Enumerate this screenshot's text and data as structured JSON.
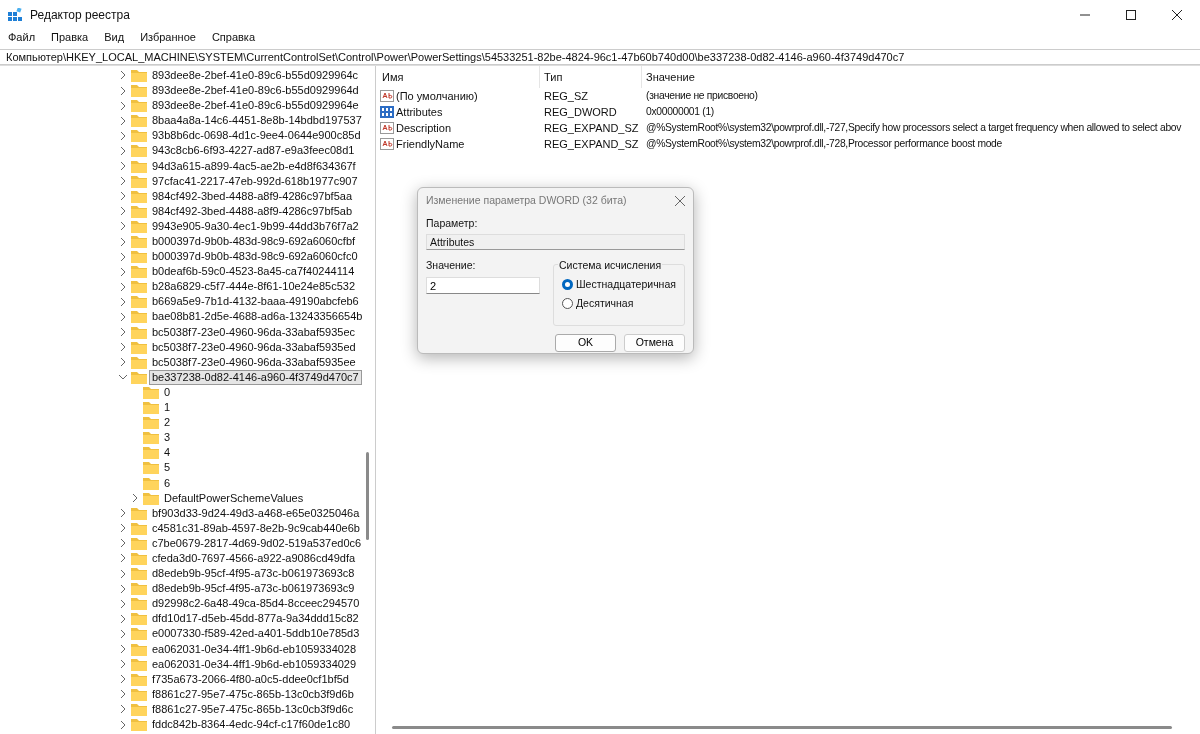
{
  "window": {
    "title": "Редактор реестра"
  },
  "menu": [
    "Файл",
    "Правка",
    "Вид",
    "Избранное",
    "Справка"
  ],
  "address": "Компьютер\\HKEY_LOCAL_MACHINE\\SYSTEM\\CurrentControlSet\\Control\\Power\\PowerSettings\\54533251-82be-4824-96c1-47b60b740d00\\be337238-0d82-4146-a960-4f3749d470c7",
  "tree": {
    "items": [
      {
        "label": "893dee8e-2bef-41e0-89c6-b55d0929964c",
        "expandable": true,
        "expanded": false,
        "selected": false
      },
      {
        "label": "893dee8e-2bef-41e0-89c6-b55d0929964d",
        "expandable": true,
        "expanded": false,
        "selected": false
      },
      {
        "label": "893dee8e-2bef-41e0-89c6-b55d0929964e",
        "expandable": true,
        "expanded": false,
        "selected": false
      },
      {
        "label": "8baa4a8a-14c6-4451-8e8b-14bdbd197537",
        "expandable": true,
        "expanded": false,
        "selected": false
      },
      {
        "label": "93b8b6dc-0698-4d1c-9ee4-0644e900c85d",
        "expandable": true,
        "expanded": false,
        "selected": false
      },
      {
        "label": "943c8cb6-6f93-4227-ad87-e9a3feec08d1",
        "expandable": true,
        "expanded": false,
        "selected": false
      },
      {
        "label": "94d3a615-a899-4ac5-ae2b-e4d8f634367f",
        "expandable": true,
        "expanded": false,
        "selected": false
      },
      {
        "label": "97cfac41-2217-47eb-992d-618b1977c907",
        "expandable": true,
        "expanded": false,
        "selected": false
      },
      {
        "label": "984cf492-3bed-4488-a8f9-4286c97bf5aa",
        "expandable": true,
        "expanded": false,
        "selected": false
      },
      {
        "label": "984cf492-3bed-4488-a8f9-4286c97bf5ab",
        "expandable": true,
        "expanded": false,
        "selected": false
      },
      {
        "label": "9943e905-9a30-4ec1-9b99-44dd3b76f7a2",
        "expandable": true,
        "expanded": false,
        "selected": false
      },
      {
        "label": "b000397d-9b0b-483d-98c9-692a6060cfbf",
        "expandable": true,
        "expanded": false,
        "selected": false
      },
      {
        "label": "b000397d-9b0b-483d-98c9-692a6060cfc0",
        "expandable": true,
        "expanded": false,
        "selected": false
      },
      {
        "label": "b0deaf6b-59c0-4523-8a45-ca7f40244114",
        "expandable": true,
        "expanded": false,
        "selected": false
      },
      {
        "label": "b28a6829-c5f7-444e-8f61-10e24e85c532",
        "expandable": true,
        "expanded": false,
        "selected": false
      },
      {
        "label": "b669a5e9-7b1d-4132-baaa-49190abcfeb6",
        "expandable": true,
        "expanded": false,
        "selected": false
      },
      {
        "label": "bae08b81-2d5e-4688-ad6a-13243356654b",
        "expandable": true,
        "expanded": false,
        "selected": false
      },
      {
        "label": "bc5038f7-23e0-4960-96da-33abaf5935ec",
        "expandable": true,
        "expanded": false,
        "selected": false
      },
      {
        "label": "bc5038f7-23e0-4960-96da-33abaf5935ed",
        "expandable": true,
        "expanded": false,
        "selected": false
      },
      {
        "label": "bc5038f7-23e0-4960-96da-33abaf5935ee",
        "expandable": true,
        "expanded": false,
        "selected": false
      },
      {
        "label": "be337238-0d82-4146-a960-4f3749d470c7",
        "expandable": true,
        "expanded": true,
        "selected": true,
        "children": [
          {
            "label": "0",
            "expandable": false,
            "selected": false
          },
          {
            "label": "1",
            "expandable": false,
            "selected": false
          },
          {
            "label": "2",
            "expandable": false,
            "selected": false
          },
          {
            "label": "3",
            "expandable": false,
            "selected": false
          },
          {
            "label": "4",
            "expandable": false,
            "selected": false
          },
          {
            "label": "5",
            "expandable": false,
            "selected": false
          },
          {
            "label": "6",
            "expandable": false,
            "selected": false
          },
          {
            "label": "DefaultPowerSchemeValues",
            "expandable": true,
            "expanded": false,
            "selected": false
          }
        ]
      },
      {
        "label": "bf903d33-9d24-49d3-a468-e65e0325046a",
        "expandable": true,
        "expanded": false,
        "selected": false
      },
      {
        "label": "c4581c31-89ab-4597-8e2b-9c9cab440e6b",
        "expandable": true,
        "expanded": false,
        "selected": false
      },
      {
        "label": "c7be0679-2817-4d69-9d02-519a537ed0c6",
        "expandable": true,
        "expanded": false,
        "selected": false
      },
      {
        "label": "cfeda3d0-7697-4566-a922-a9086cd49dfa",
        "expandable": true,
        "expanded": false,
        "selected": false
      },
      {
        "label": "d8edeb9b-95cf-4f95-a73c-b061973693c8",
        "expandable": true,
        "expanded": false,
        "selected": false
      },
      {
        "label": "d8edeb9b-95cf-4f95-a73c-b061973693c9",
        "expandable": true,
        "expanded": false,
        "selected": false
      },
      {
        "label": "d92998c2-6a48-49ca-85d4-8cceec294570",
        "expandable": true,
        "expanded": false,
        "selected": false
      },
      {
        "label": "dfd10d17-d5eb-45dd-877a-9a34ddd15c82",
        "expandable": true,
        "expanded": false,
        "selected": false
      },
      {
        "label": "e0007330-f589-42ed-a401-5ddb10e785d3",
        "expandable": true,
        "expanded": false,
        "selected": false
      },
      {
        "label": "ea062031-0e34-4ff1-9b6d-eb1059334028",
        "expandable": true,
        "expanded": false,
        "selected": false
      },
      {
        "label": "ea062031-0e34-4ff1-9b6d-eb1059334029",
        "expandable": true,
        "expanded": false,
        "selected": false
      },
      {
        "label": "f735a673-2066-4f80-a0c5-ddee0cf1bf5d",
        "expandable": true,
        "expanded": false,
        "selected": false
      },
      {
        "label": "f8861c27-95e7-475c-865b-13c0cb3f9d6b",
        "expandable": true,
        "expanded": false,
        "selected": false
      },
      {
        "label": "f8861c27-95e7-475c-865b-13c0cb3f9d6c",
        "expandable": true,
        "expanded": false,
        "selected": false
      },
      {
        "label": "fddc842b-8364-4edc-94cf-c17f60de1c80",
        "expandable": true,
        "expanded": false,
        "selected": false
      }
    ]
  },
  "values": {
    "columns": [
      "Имя",
      "Тип",
      "Значение"
    ],
    "rows": [
      {
        "kind": "string",
        "name": "(По умолчанию)",
        "type": "REG_SZ",
        "data": "(значение не присвоено)"
      },
      {
        "kind": "binary",
        "name": "Attributes",
        "type": "REG_DWORD",
        "data": "0x00000001 (1)"
      },
      {
        "kind": "string",
        "name": "Description",
        "type": "REG_EXPAND_SZ",
        "data": "@%SystemRoot%\\system32\\powrprof.dll,-727,Specify how processors select a target frequency when allowed to select abov"
      },
      {
        "kind": "string",
        "name": "FriendlyName",
        "type": "REG_EXPAND_SZ",
        "data": "@%SystemRoot%\\system32\\powrprof.dll,-728,Processor performance boost mode"
      }
    ]
  },
  "dialog": {
    "title": "Изменение параметра DWORD (32 бита)",
    "param_label": "Параметр:",
    "param_value": "Attributes",
    "value_label": "Значение:",
    "value": "2",
    "base_title": "Система исчисления",
    "radios": [
      {
        "label": "Шестнадцатеричная",
        "selected": true
      },
      {
        "label": "Десятичная",
        "selected": false
      }
    ],
    "buttons": [
      {
        "label": "OK",
        "kind": "default"
      },
      {
        "label": "Отмена",
        "kind": "normal"
      }
    ]
  }
}
